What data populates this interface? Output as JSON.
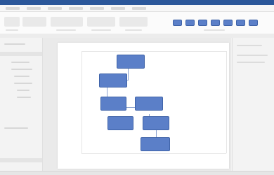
{
  "app": {
    "accent": "#2b579a",
    "shape_fill": "#5b7fc8",
    "shape_border": "#3f63a8"
  },
  "ribbon": {
    "shape_styles": [
      {
        "icon": "shape-style-icon"
      },
      {
        "icon": "shape-style-icon"
      },
      {
        "icon": "shape-style-icon"
      },
      {
        "icon": "shape-style-icon"
      },
      {
        "icon": "shape-style-icon"
      },
      {
        "icon": "shape-style-icon"
      },
      {
        "icon": "shape-style-icon"
      }
    ]
  },
  "diagram": {
    "nodes": [
      {
        "id": "node-top",
        "label": ""
      },
      {
        "id": "node-left-1",
        "label": ""
      },
      {
        "id": "node-left-2",
        "label": ""
      },
      {
        "id": "node-right-2",
        "label": ""
      },
      {
        "id": "node-left-3",
        "label": ""
      },
      {
        "id": "node-right-3",
        "label": ""
      },
      {
        "id": "node-bottom",
        "label": ""
      }
    ]
  }
}
